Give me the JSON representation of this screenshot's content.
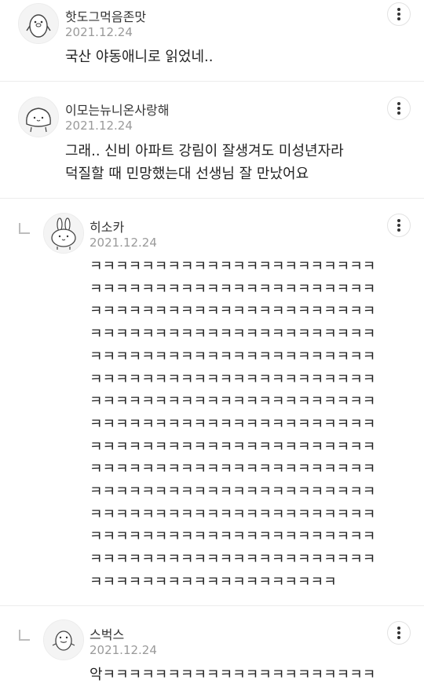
{
  "comments": [
    {
      "nickname": "핫도그먹음존맛",
      "date": "2021.12.24",
      "text": "국산 야동애니로 읽었네..",
      "avatar_icon": "penguin-avatar-icon",
      "is_reply": false
    },
    {
      "nickname": "이모는뉴니온사랑해",
      "date": "2021.12.24",
      "text": "그래.. 신비 아파트 강림이 잘생겨도 미성년자라\n덕질할 때 민망했는대 선생님 잘 만났어요",
      "avatar_icon": "blob-avatar-icon",
      "is_reply": false
    },
    {
      "nickname": "히소카",
      "date": "2021.12.24",
      "text": "ㅋㅋㅋㅋㅋㅋㅋㅋㅋㅋㅋㅋㅋㅋㅋㅋㅋㅋㅋㅋㅋㅋ\nㅋㅋㅋㅋㅋㅋㅋㅋㅋㅋㅋㅋㅋㅋㅋㅋㅋㅋㅋㅋㅋㅋ\nㅋㅋㅋㅋㅋㅋㅋㅋㅋㅋㅋㅋㅋㅋㅋㅋㅋㅋㅋㅋㅋㅋ\nㅋㅋㅋㅋㅋㅋㅋㅋㅋㅋㅋㅋㅋㅋㅋㅋㅋㅋㅋㅋㅋㅋ\nㅋㅋㅋㅋㅋㅋㅋㅋㅋㅋㅋㅋㅋㅋㅋㅋㅋㅋㅋㅋㅋㅋ\nㅋㅋㅋㅋㅋㅋㅋㅋㅋㅋㅋㅋㅋㅋㅋㅋㅋㅋㅋㅋㅋㅋ\nㅋㅋㅋㅋㅋㅋㅋㅋㅋㅋㅋㅋㅋㅋㅋㅋㅋㅋㅋㅋㅋㅋ\nㅋㅋㅋㅋㅋㅋㅋㅋㅋㅋㅋㅋㅋㅋㅋㅋㅋㅋㅋㅋㅋㅋ\nㅋㅋㅋㅋㅋㅋㅋㅋㅋㅋㅋㅋㅋㅋㅋㅋㅋㅋㅋㅋㅋㅋ\nㅋㅋㅋㅋㅋㅋㅋㅋㅋㅋㅋㅋㅋㅋㅋㅋㅋㅋㅋㅋㅋㅋ\nㅋㅋㅋㅋㅋㅋㅋㅋㅋㅋㅋㅋㅋㅋㅋㅋㅋㅋㅋㅋㅋㅋ\nㅋㅋㅋㅋㅋㅋㅋㅋㅋㅋㅋㅋㅋㅋㅋㅋㅋㅋㅋㅋㅋㅋ\nㅋㅋㅋㅋㅋㅋㅋㅋㅋㅋㅋㅋㅋㅋㅋㅋㅋㅋㅋㅋㅋㅋ\nㅋㅋㅋㅋㅋㅋㅋㅋㅋㅋㅋㅋㅋㅋㅋㅋㅋㅋㅋㅋㅋㅋ\nㅋㅋㅋㅋㅋㅋㅋㅋㅋㅋㅋㅋㅋㅋㅋㅋㅋㅋㅋ",
      "avatar_icon": "bunny-avatar-icon",
      "is_reply": true
    },
    {
      "nickname": "스벅스",
      "date": "2021.12.24",
      "text": "악ㅋㅋㅋㅋㅋㅋㅋㅋㅋㅋㅋㅋㅋㅋㅋㅋㅋㅋㅋㅋㅋ",
      "avatar_icon": "duck-avatar-icon",
      "is_reply": true
    }
  ],
  "icons": {
    "more_menu": "more-vertical-icon",
    "reply_marker": "reply-arrow-icon"
  },
  "colors": {
    "background": "#ffffff",
    "date_text": "#9a9a9a",
    "divider": "#ececec"
  }
}
